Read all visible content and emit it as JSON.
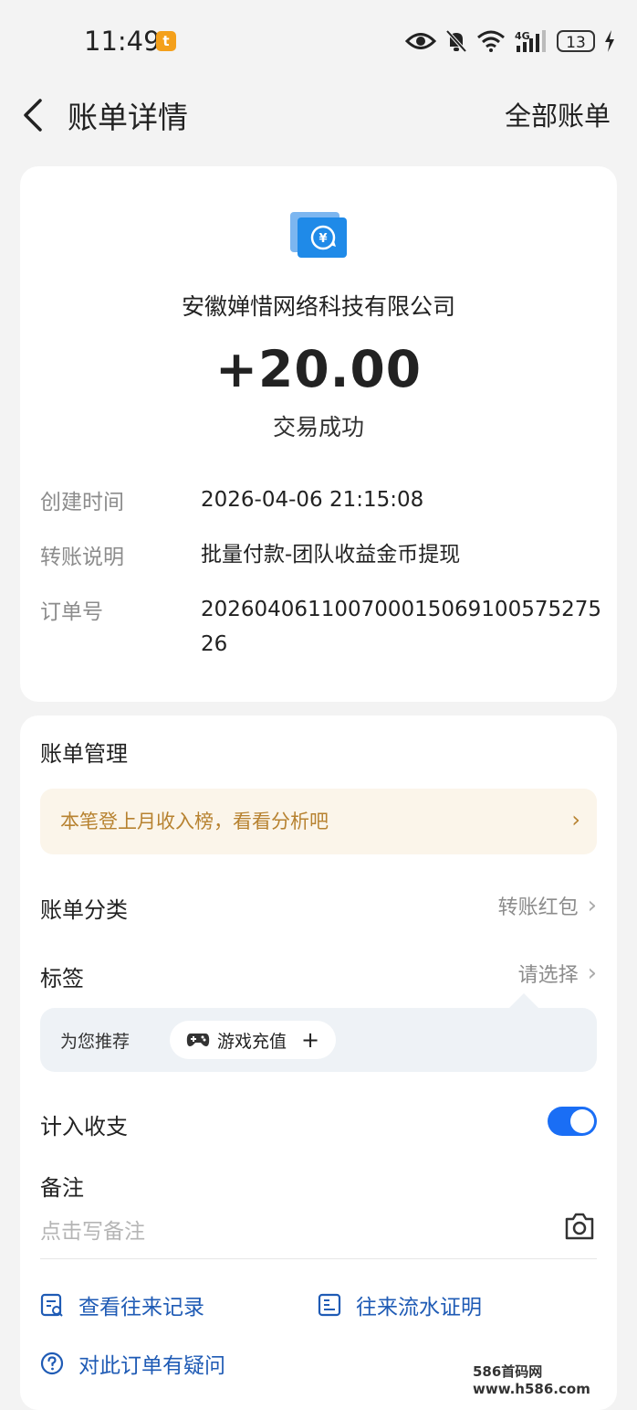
{
  "status_bar": {
    "time": "11:49",
    "badge": "t",
    "battery": "13"
  },
  "topbar": {
    "title": "账单详情",
    "right_link": "全部账单"
  },
  "transaction": {
    "merchant": "安徽婵惜网络科技有限公司",
    "amount": "+20.00",
    "status": "交易成功",
    "details": [
      {
        "label": "创建时间",
        "value": "2026-04-06 21:15:08"
      },
      {
        "label": "转账说明",
        "value": "批量付款-团队收益金币提现"
      },
      {
        "label": "订单号",
        "value": "20260406110070001506910057527526"
      }
    ]
  },
  "management": {
    "title": "账单管理",
    "promo": "本笔登上月收入榜，看看分析吧",
    "category_label": "账单分类",
    "category_value": "转账红包",
    "tag_label": "标签",
    "tag_value": "请选择",
    "recommend_label": "为您推荐",
    "recommend_chip": "游戏充值",
    "recommend_add": "+",
    "income_label": "计入收支",
    "income_enabled": true,
    "remark_label": "备注",
    "remark_placeholder": "点击写备注",
    "links": {
      "history": "查看往来记录",
      "proof": "往来流水证明",
      "question": "对此订单有疑问"
    }
  },
  "watermark": "586首码网 www.h586.com",
  "colors": {
    "accent": "#1a6ef5",
    "link": "#1f5bb5",
    "promo_text": "#b78230"
  }
}
